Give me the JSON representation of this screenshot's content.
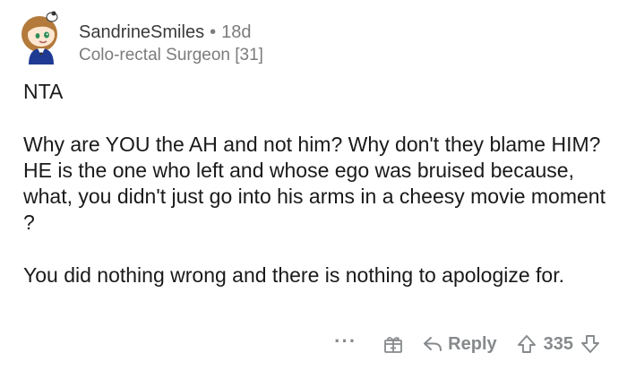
{
  "comment": {
    "username": "SandrineSmiles",
    "separator": "•",
    "age": "18d",
    "flair": "Colo-rectal Surgeon [31]",
    "paragraphs": [
      "NTA",
      "Why are YOU the AH and not him? Why don't they blame HIM? HE is the one who left and whose ego was bruised because, what, you didn't just go into his arms in a cheesy movie moment ?",
      "You did nothing wrong and there is nothing to apologize for."
    ]
  },
  "actions": {
    "more": "···",
    "reply_label": "Reply",
    "vote_count": "335"
  },
  "icons": {
    "avatar": "snoo-avatar",
    "award": "gift-award-icon",
    "reply": "reply-arrow-icon",
    "upvote": "upvote-arrow-icon",
    "downvote": "downvote-arrow-icon"
  },
  "colors": {
    "text": "#1a1a1b",
    "meta": "#7c7c7c",
    "action": "#878a8c"
  }
}
